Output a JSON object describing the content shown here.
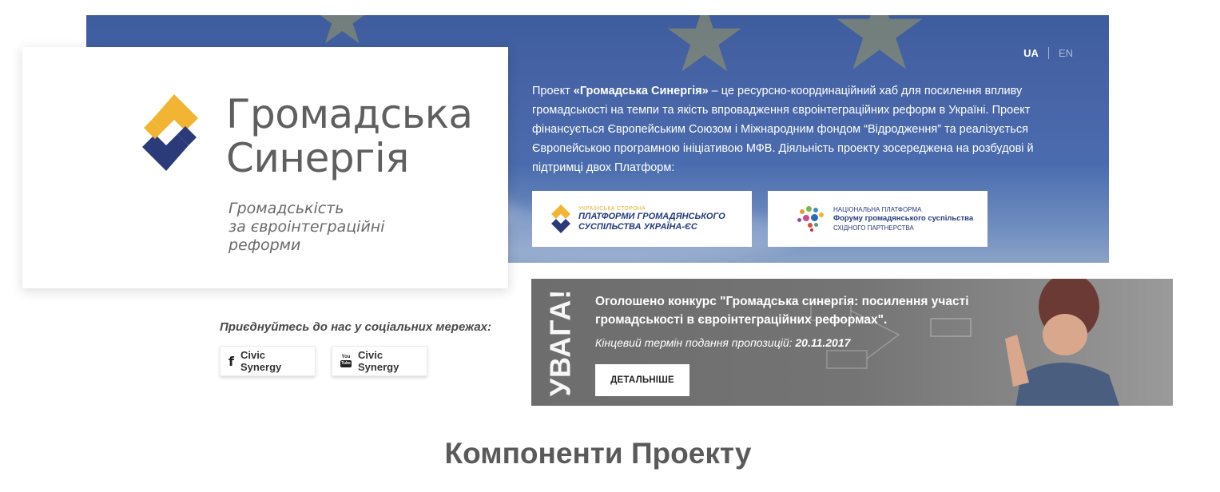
{
  "language": {
    "ua": "UA",
    "en": "EN"
  },
  "logo": {
    "title_line1": "Громадська",
    "title_line2": "Синергія",
    "subtitle_line1": "Громадськість",
    "subtitle_line2": "за євроінтеграційні",
    "subtitle_line3": "реформи"
  },
  "hero": {
    "text_prefix": "Проект ",
    "text_bold": "«Громадська Синергія»",
    "text_rest": " – це ресурсно-координаційний хаб для посилення впливу громадськості на темпи та якість впровадження євроінтеграційних реформ в Україні. Проект фінансується Європейським Союзом і Міжнародним фондом “Відродження” та реалізується Європейською програмною ініціативою МФВ. Діяльність проекту зосереджена на розбудові й підтримці двох Платформ:"
  },
  "platforms": [
    {
      "small": "УКРАЇНСЬКА СТОРОНА",
      "line1": "ПЛАТФОРМИ ГРОМАДЯНСЬКОГО",
      "line2": "СУСПІЛЬСТВА УКРАЇНА-ЄС"
    },
    {
      "line1": "НАЦІОНАЛЬНА ПЛАТФОРМА",
      "line2": "Форуму громадянського суспільства",
      "line3": "СХІДНОГО ПАРТНЕРСТВА"
    }
  ],
  "social": {
    "label": "Приєднуйтесь до нас у соціальних мережах:",
    "facebook_label": "Civic Synergy",
    "facebook_icon": "f",
    "youtube_label": "Civic Synergy",
    "youtube_icon_top": "You",
    "youtube_icon_bottom": "Tube"
  },
  "notice": {
    "badge": "УВАГА!",
    "title": "Оголошено конкурс \"Громадська синергія: посилення участі громадськості в євроінтеграційних реформах\".",
    "deadline_label": "Кінцевий термін подання пропозицій:",
    "deadline_date": "20.11.2017",
    "button": "ДЕТАЛЬНІШЕ"
  },
  "section_title": "Компоненти Проекту",
  "colors": {
    "hero_blue": "#4865a8",
    "logo_yellow": "#f2b533",
    "logo_navy": "#2b3a78",
    "notice_gray": "#747474"
  }
}
